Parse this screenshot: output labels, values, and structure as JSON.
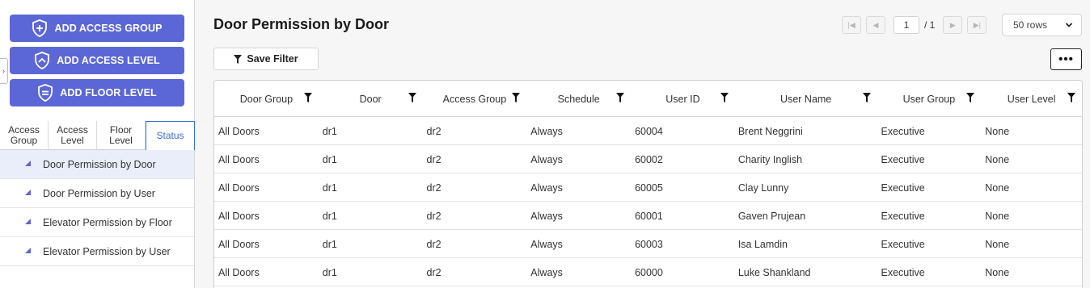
{
  "sidebar": {
    "actions": [
      {
        "label": "ADD ACCESS GROUP",
        "icon": "plus-shield-icon"
      },
      {
        "label": "ADD ACCESS LEVEL",
        "icon": "chevron-up-shield-icon"
      },
      {
        "label": "ADD FLOOR LEVEL",
        "icon": "equals-shield-icon"
      }
    ],
    "tabs": [
      {
        "line1": "Access",
        "line2": "Group"
      },
      {
        "line1": "Access",
        "line2": "Level"
      },
      {
        "line1": "Floor",
        "line2": "Level"
      },
      {
        "line1": "Status",
        "line2": ""
      }
    ],
    "active_tab": "Status",
    "items": [
      {
        "label": "Door Permission by Door",
        "active": true
      },
      {
        "label": "Door Permission by User",
        "active": false
      },
      {
        "label": "Elevator Permission by Floor",
        "active": false
      },
      {
        "label": "Elevator Permission by User",
        "active": false
      }
    ]
  },
  "main": {
    "title": "Door Permission by Door",
    "pager": {
      "page": "1",
      "total": "/ 1"
    },
    "rows_per_page": "50 rows",
    "save_filter_label": "Save Filter",
    "more_label": "•••",
    "columns": [
      "Door Group",
      "Door",
      "Access Group",
      "Schedule",
      "User ID",
      "User Name",
      "User Group",
      "User Level"
    ],
    "rows": [
      [
        "All Doors",
        "dr1",
        "dr2",
        "Always",
        "60004",
        "Brent Neggrini",
        "Executive",
        "None"
      ],
      [
        "All Doors",
        "dr1",
        "dr2",
        "Always",
        "60002",
        "Charity Inglish",
        "Executive",
        "None"
      ],
      [
        "All Doors",
        "dr1",
        "dr2",
        "Always",
        "60005",
        "Clay Lunny",
        "Executive",
        "None"
      ],
      [
        "All Doors",
        "dr1",
        "dr2",
        "Always",
        "60001",
        "Gaven Prujean",
        "Executive",
        "None"
      ],
      [
        "All Doors",
        "dr1",
        "dr2",
        "Always",
        "60003",
        "Isa Lamdin",
        "Executive",
        "None"
      ],
      [
        "All Doors",
        "dr1",
        "dr2",
        "Always",
        "60000",
        "Luke Shankland",
        "Executive",
        "None"
      ]
    ]
  },
  "colors": {
    "accent": "#5b67d6",
    "active_tab": "#3a6fd8",
    "active_row_bg": "#e9eefa"
  }
}
